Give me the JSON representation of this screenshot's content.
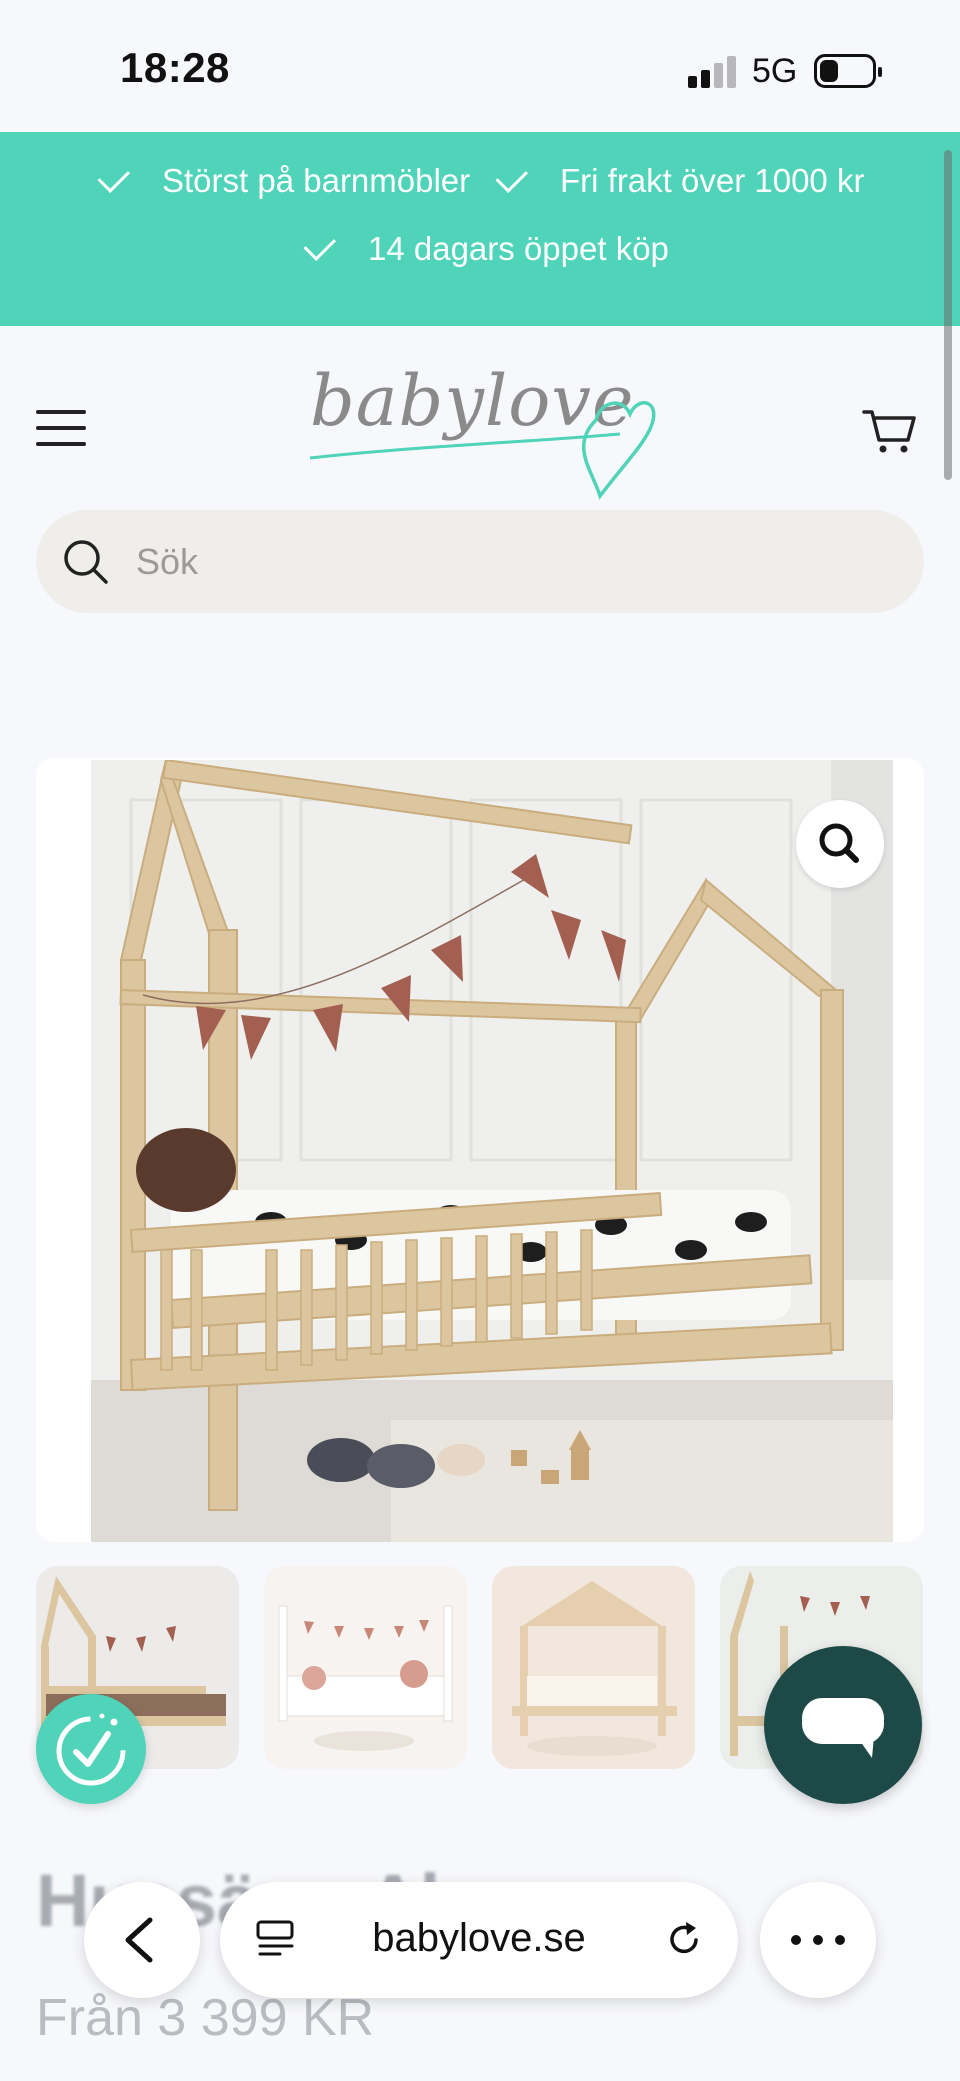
{
  "status_bar": {
    "time": "18:28",
    "network": "5G"
  },
  "announcement": {
    "items": [
      "Störst på barnmöbler",
      "Fri frakt över 1000 kr",
      "14 dagars öppet köp"
    ]
  },
  "header": {
    "logo_text": "babylove"
  },
  "search": {
    "placeholder": "Sök"
  },
  "product": {
    "title": "Hussäng Alex",
    "price": "Från 3 399 KR"
  },
  "browser": {
    "url": "babylove.se"
  },
  "colors": {
    "accent": "#4fd3b9",
    "chat": "#1d4a47"
  }
}
